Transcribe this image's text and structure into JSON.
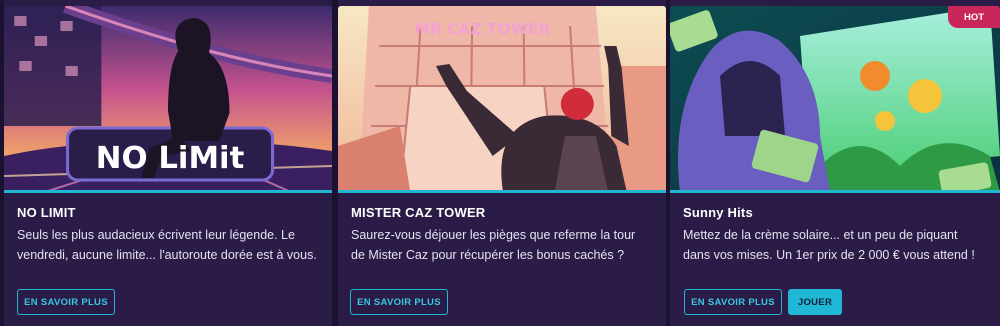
{
  "cards": [
    {
      "title": "NO LIMIT",
      "description": "Seuls les plus audacieux écrivent leur légende. Le vendredi, aucune limite... l'autoroute dorée est à vous.",
      "art_text": "NO LiMit",
      "buttons": {
        "more": "EN SAVOIR PLUS"
      }
    },
    {
      "title": "MISTER CAZ TOWER",
      "description": "Saurez-vous déjouer les pièges que referme la tour de Mister Caz pour récupérer les bonus cachés ?",
      "art_text": "MR CAZ TOWER",
      "buttons": {
        "more": "EN SAVOIR PLUS"
      }
    },
    {
      "title": "Sunny Hits",
      "description": "Mettez de la crème solaire... et un peu de piquant dans vos mises. Un 1er prix de 2 000 € vous attend !",
      "badge": "HOT",
      "buttons": {
        "more": "EN SAVOIR PLUS",
        "play": "JOUER"
      }
    }
  ],
  "colors": {
    "background": "#1b1130",
    "card": "#2a1c47",
    "accent": "#1fb7d4",
    "hot": "#c9265a"
  }
}
